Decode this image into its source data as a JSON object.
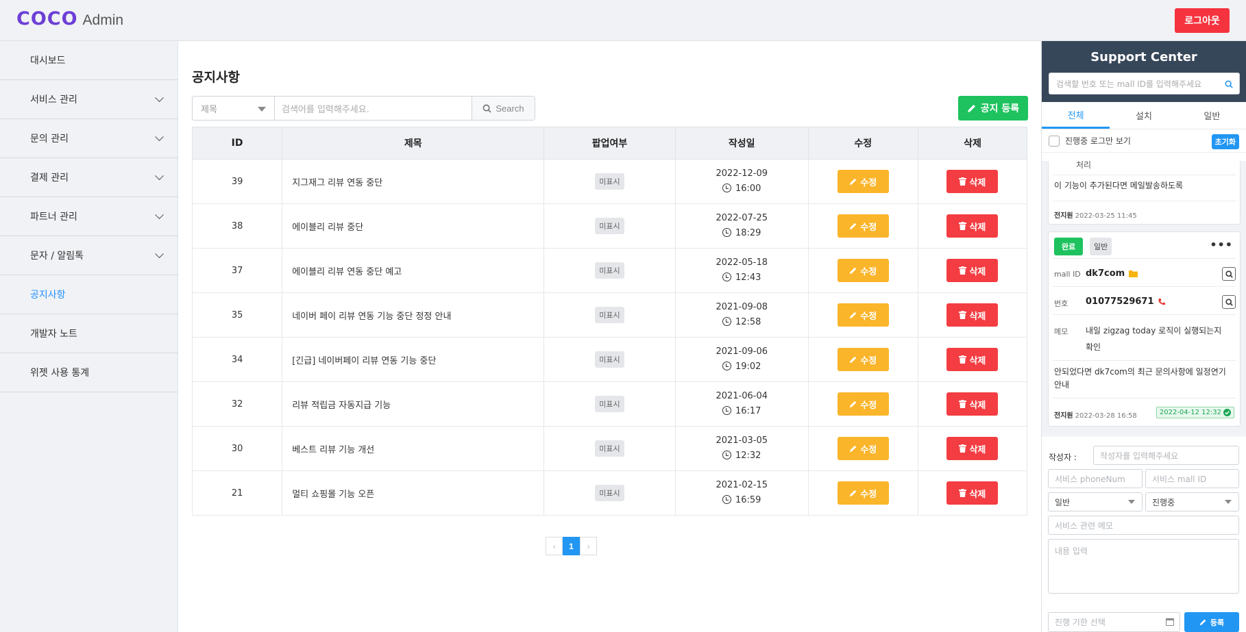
{
  "header": {
    "logo_main": "COCO",
    "logo_sub": "Admin",
    "logout_label": "로그아웃"
  },
  "sidebar": {
    "items": [
      {
        "label": "대시보드",
        "has_submenu": false,
        "active": false
      },
      {
        "label": "서비스 관리",
        "has_submenu": true,
        "active": false
      },
      {
        "label": "문의 관리",
        "has_submenu": true,
        "active": false
      },
      {
        "label": "결제 관리",
        "has_submenu": true,
        "active": false
      },
      {
        "label": "파트너 관리",
        "has_submenu": true,
        "active": false
      },
      {
        "label": "문자 / 알림톡",
        "has_submenu": true,
        "active": false
      },
      {
        "label": "공지사항",
        "has_submenu": false,
        "active": true
      },
      {
        "label": "개발자 노트",
        "has_submenu": false,
        "active": false
      },
      {
        "label": "위젯 사용 통계",
        "has_submenu": false,
        "active": false
      }
    ]
  },
  "main": {
    "title": "공지사항",
    "search": {
      "field_selected": "제목",
      "placeholder": "검색어를 입력해주세요.",
      "button_label": "Search"
    },
    "add_button_label": "공지 등록",
    "table": {
      "headers": [
        "ID",
        "제목",
        "팝업여부",
        "작성일",
        "수정",
        "삭제"
      ],
      "edit_label": "수정",
      "delete_label": "삭제",
      "rows": [
        {
          "id": "39",
          "title": "지그재그 리뷰 연동 중단",
          "popup": "미표시",
          "date": "2022-12-09",
          "time": "16:00"
        },
        {
          "id": "38",
          "title": "에이블리 리뷰 중단",
          "popup": "미표시",
          "date": "2022-07-25",
          "time": "18:29"
        },
        {
          "id": "37",
          "title": "에이블리 리뷰 연동 중단 예고",
          "popup": "미표시",
          "date": "2022-05-18",
          "time": "12:43"
        },
        {
          "id": "35",
          "title": "네이버 페이 리뷰 연동 기능 중단 정정 안내",
          "popup": "미표시",
          "date": "2021-09-08",
          "time": "12:58"
        },
        {
          "id": "34",
          "title": "[긴급] 네이버페이 리뷰 연동 기능 중단",
          "popup": "미표시",
          "date": "2021-09-06",
          "time": "19:02"
        },
        {
          "id": "32",
          "title": "리뷰 적립금 자동지급 기능",
          "popup": "미표시",
          "date": "2021-06-04",
          "time": "16:17"
        },
        {
          "id": "30",
          "title": "베스트 리뷰 기능 개선",
          "popup": "미표시",
          "date": "2021-03-05",
          "time": "12:32"
        },
        {
          "id": "21",
          "title": "멀티 쇼핑몰 기능 오픈",
          "popup": "미표시",
          "date": "2021-02-15",
          "time": "16:59"
        }
      ]
    },
    "pagination": {
      "prev": "‹",
      "current": "1",
      "next": "›"
    }
  },
  "support": {
    "title": "Support Center",
    "search_placeholder": "검색할 번호 또는 mall ID를 입력해주세요",
    "tabs": [
      "전체",
      "설치",
      "일반"
    ],
    "active_tab": "전체",
    "filter_label": "진행중 로그만 보기",
    "reset_label": "초기화",
    "card1": {
      "cut_text": "처리",
      "message": "이 기능이 추가된다면 메일발송하도록",
      "author": "전지원",
      "datetime": "2022-03-25 11:45"
    },
    "card2": {
      "status": "완료",
      "category": "일반",
      "mall_id_label": "mall ID",
      "mall_id": "dk7com",
      "phone_label": "번호",
      "phone": "01077529671",
      "memo_label": "메모",
      "memo": "내일 zigzag today 로직이 실행되는지 확인",
      "message": "안되었다면 dk7com의 최근 문의사항에 일정연기 안내",
      "author": "전지원",
      "datetime": "2022-03-28 16:58",
      "done_at": "2022-04-12 12:32"
    },
    "form": {
      "author_label": "작성자 :",
      "author_placeholder": "작성자를 입력해주세요",
      "phone_placeholder": "서비스 phoneNum",
      "mall_placeholder": "서비스 mall ID",
      "category_selected": "일반",
      "status_selected": "진행중",
      "memo_placeholder": "서비스 관련 메모",
      "content_placeholder": "내용 입력",
      "deadline_placeholder": "진행 기한 선택",
      "submit_label": "등록"
    }
  },
  "colors": {
    "brand": "#6d3fd6",
    "logout": "#f5333f",
    "add": "#1ec25e",
    "edit": "#fbb52a",
    "delete": "#f33d42",
    "accent": "#2196f3",
    "panel_header": "#37475a"
  }
}
